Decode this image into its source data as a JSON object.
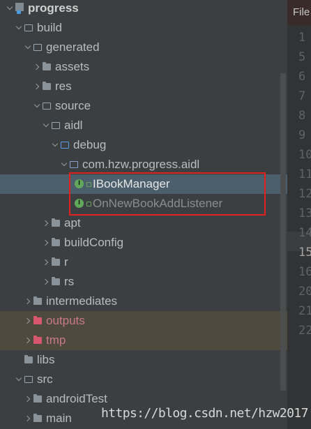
{
  "editor": {
    "tab_label": "File",
    "line_numbers": [
      "1",
      "5",
      "6",
      "7",
      "8",
      "9",
      "10",
      "11",
      "12",
      "13",
      "14",
      "15",
      "16",
      "20",
      "21",
      "22"
    ]
  },
  "tree": {
    "items": [
      {
        "label": "progress",
        "depth": 0,
        "arrow": "open",
        "icon": "module-folder-icon",
        "style": "bold"
      },
      {
        "label": "build",
        "depth": 1,
        "arrow": "open",
        "icon": "folder-icon",
        "style": "normal"
      },
      {
        "label": "generated",
        "depth": 2,
        "arrow": "open",
        "icon": "folder-icon",
        "style": "normal"
      },
      {
        "label": "assets",
        "depth": 3,
        "arrow": "closed",
        "icon": "folder-icon",
        "style": "normal"
      },
      {
        "label": "res",
        "depth": 3,
        "arrow": "closed",
        "icon": "folder-icon",
        "style": "normal"
      },
      {
        "label": "source",
        "depth": 3,
        "arrow": "open",
        "icon": "folder-icon",
        "style": "normal"
      },
      {
        "label": "aidl",
        "depth": 4,
        "arrow": "open",
        "icon": "folder-icon",
        "style": "normal"
      },
      {
        "label": "debug",
        "depth": 5,
        "arrow": "open",
        "icon": "source-folder-icon",
        "style": "normal"
      },
      {
        "label": "com.hzw.progress.aidl",
        "depth": 6,
        "arrow": "open",
        "icon": "package-icon",
        "style": "normal"
      },
      {
        "label": "IBookManager",
        "depth": 7,
        "arrow": "none",
        "icon": "interface-icon",
        "style": "white",
        "selected": true
      },
      {
        "label": "OnNewBookAddListener",
        "depth": 7,
        "arrow": "none",
        "icon": "interface-icon",
        "style": "dim"
      },
      {
        "label": "apt",
        "depth": 4,
        "arrow": "closed",
        "icon": "folder-icon",
        "style": "normal"
      },
      {
        "label": "buildConfig",
        "depth": 4,
        "arrow": "closed",
        "icon": "folder-icon",
        "style": "normal"
      },
      {
        "label": "r",
        "depth": 4,
        "arrow": "closed",
        "icon": "folder-icon",
        "style": "normal"
      },
      {
        "label": "rs",
        "depth": 4,
        "arrow": "closed",
        "icon": "folder-icon",
        "style": "normal"
      },
      {
        "label": "intermediates",
        "depth": 2,
        "arrow": "closed",
        "icon": "folder-icon",
        "style": "normal"
      },
      {
        "label": "outputs",
        "depth": 2,
        "arrow": "closed",
        "icon": "excluded-folder-icon",
        "style": "red",
        "excluded": true
      },
      {
        "label": "tmp",
        "depth": 2,
        "arrow": "closed",
        "icon": "excluded-folder-icon",
        "style": "red",
        "excluded": true
      },
      {
        "label": "libs",
        "depth": 1,
        "arrow": "none",
        "icon": "folder-icon",
        "style": "normal"
      },
      {
        "label": "src",
        "depth": 1,
        "arrow": "open",
        "icon": "folder-icon",
        "style": "normal"
      },
      {
        "label": "androidTest",
        "depth": 2,
        "arrow": "closed",
        "icon": "folder-icon",
        "style": "normal"
      },
      {
        "label": "main",
        "depth": 2,
        "arrow": "closed",
        "icon": "folder-icon",
        "style": "normal"
      }
    ]
  },
  "watermark": "https://blog.csdn.net/hzw2017",
  "colors": {
    "panel_bg": "#3c3f41",
    "selection": "#4b5e6b",
    "excluded_row": "#4f4a3e",
    "highlight_border": "#e2201c"
  }
}
